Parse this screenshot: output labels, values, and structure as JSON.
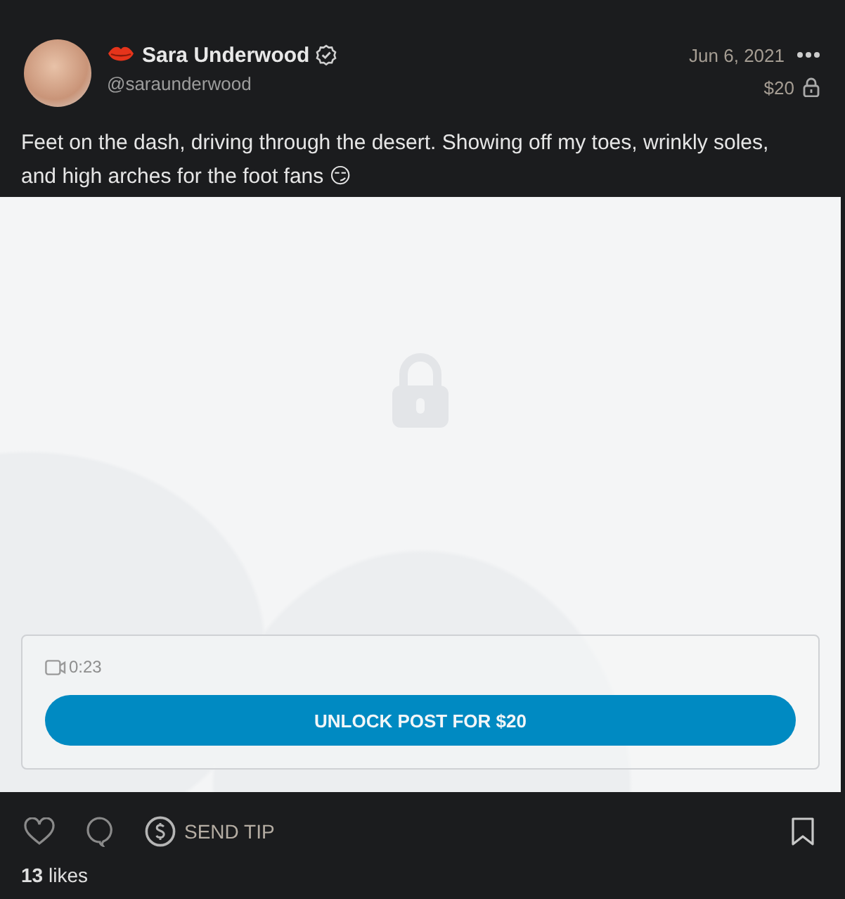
{
  "post": {
    "author": {
      "name": "Sara Underwood",
      "verified": true,
      "handle": "@saraunderwood"
    },
    "date": "Jun 6, 2021",
    "price": "$20",
    "locked": true,
    "text": "Feet on the dash, driving through the desert. Showing off my toes, wrinkly soles, and high arches for the foot fans 😏",
    "media": {
      "duration": "0:23",
      "unlock_button": "UNLOCK POST FOR $20"
    },
    "actions": {
      "liked": false,
      "bookmarked": false,
      "tip_label": "SEND TIP"
    },
    "likes": "**13** likes"
  }
}
